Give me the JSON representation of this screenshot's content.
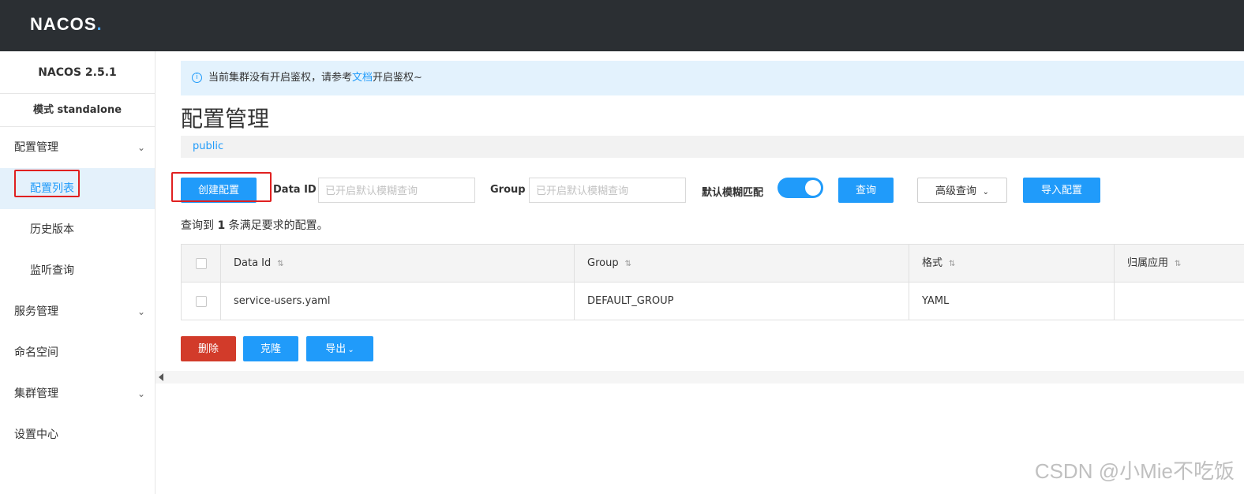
{
  "header": {
    "logo_main": "NACOS",
    "logo_dot": "."
  },
  "sidebar": {
    "version": "NACOS 2.5.1",
    "mode": "模式 standalone",
    "items": [
      {
        "label": "配置管理",
        "chevron": "chevron-down-icon"
      },
      {
        "label": "配置列表",
        "active": true
      },
      {
        "label": "历史版本"
      },
      {
        "label": "监听查询"
      },
      {
        "label": "服务管理",
        "chevron": "chevron-down-icon"
      },
      {
        "label": "命名空间"
      },
      {
        "label": "集群管理",
        "chevron": "chevron-down-icon"
      },
      {
        "label": "设置中心"
      }
    ]
  },
  "notice": {
    "icon": "info-icon",
    "text_before": "当前集群没有开启鉴权，请参考",
    "link": "文档",
    "text_after": "开启鉴权~"
  },
  "page": {
    "title": "配置管理",
    "namespace": "public"
  },
  "toolbar": {
    "create_label": "创建配置",
    "data_id_label": "Data ID",
    "data_id_placeholder": "已开启默认模糊查询",
    "group_label": "Group",
    "group_placeholder": "已开启默认模糊查询",
    "fuzzy_label": "默认模糊匹配",
    "fuzzy_on": true,
    "query_label": "查询",
    "advanced_label": "高级查询",
    "import_label": "导入配置"
  },
  "result": {
    "prefix": "查询到 ",
    "count": "1",
    "suffix": " 条满足要求的配置。"
  },
  "table": {
    "columns": [
      "Data Id",
      "Group",
      "格式",
      "归属应用"
    ],
    "rows": [
      {
        "data_id": "service-users.yaml",
        "group": "DEFAULT_GROUP",
        "format": "YAML",
        "app": ""
      }
    ]
  },
  "bulk": {
    "delete_label": "删除",
    "clone_label": "克隆",
    "export_label": "导出"
  },
  "watermark": "CSDN @小Mie不吃饭",
  "colors": {
    "primary": "#209bfa",
    "danger": "#d23b2a",
    "header_bg": "#2b2f33",
    "highlight": "#e02020"
  }
}
